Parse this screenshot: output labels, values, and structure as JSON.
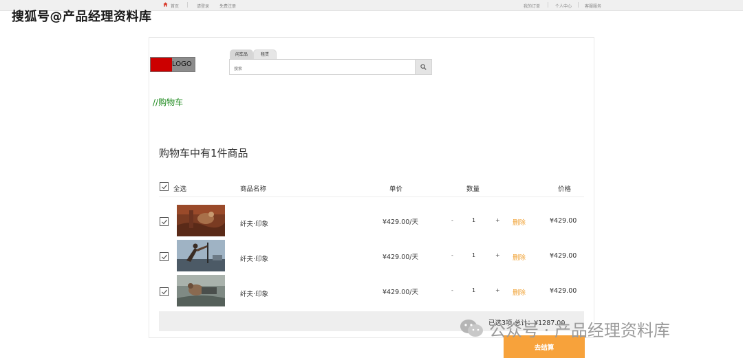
{
  "topbar": {
    "home": "首页",
    "login": "请登录",
    "register": "免费注册",
    "my_orders": "我的订单",
    "personal_center": "个人中心",
    "customer_service": "客服服务"
  },
  "watermark": {
    "top": "搜狐号@产品经理资料库",
    "bottom": "公众号 · 产品经理资料库"
  },
  "logo": {
    "text": "LOGO"
  },
  "search": {
    "tabs": [
      "闲车品",
      "租赁"
    ],
    "placeholder": "搜索"
  },
  "breadcrumb": "//购物车",
  "cart": {
    "title": "购物车中有1件商品",
    "headers": {
      "select_all": "全选",
      "name": "商品名称",
      "unit_price": "单价",
      "quantity": "数量",
      "price": "价格"
    },
    "items": [
      {
        "name": "纤夫·印象",
        "unit_price": "¥429.00/天",
        "minus": "-",
        "qty": "1",
        "plus": "+",
        "delete": "删除",
        "price": "¥429.00",
        "checked": true
      },
      {
        "name": "纤夫·印象",
        "unit_price": "¥429.00/天",
        "minus": "-",
        "qty": "1",
        "plus": "+",
        "delete": "删除",
        "price": "¥429.00",
        "checked": true
      },
      {
        "name": "纤夫·印象",
        "unit_price": "¥429.00/天",
        "minus": "-",
        "qty": "1",
        "plus": "+",
        "delete": "删除",
        "price": "¥429.00",
        "checked": true
      }
    ],
    "summary": "已选3项  总计：¥1287.00",
    "checkout": "去结算"
  },
  "colors": {
    "accent": "#f7a23b",
    "delete": "#f0a030",
    "breadcrumb": "#1e8a1e",
    "logo_red": "#cc0000"
  }
}
